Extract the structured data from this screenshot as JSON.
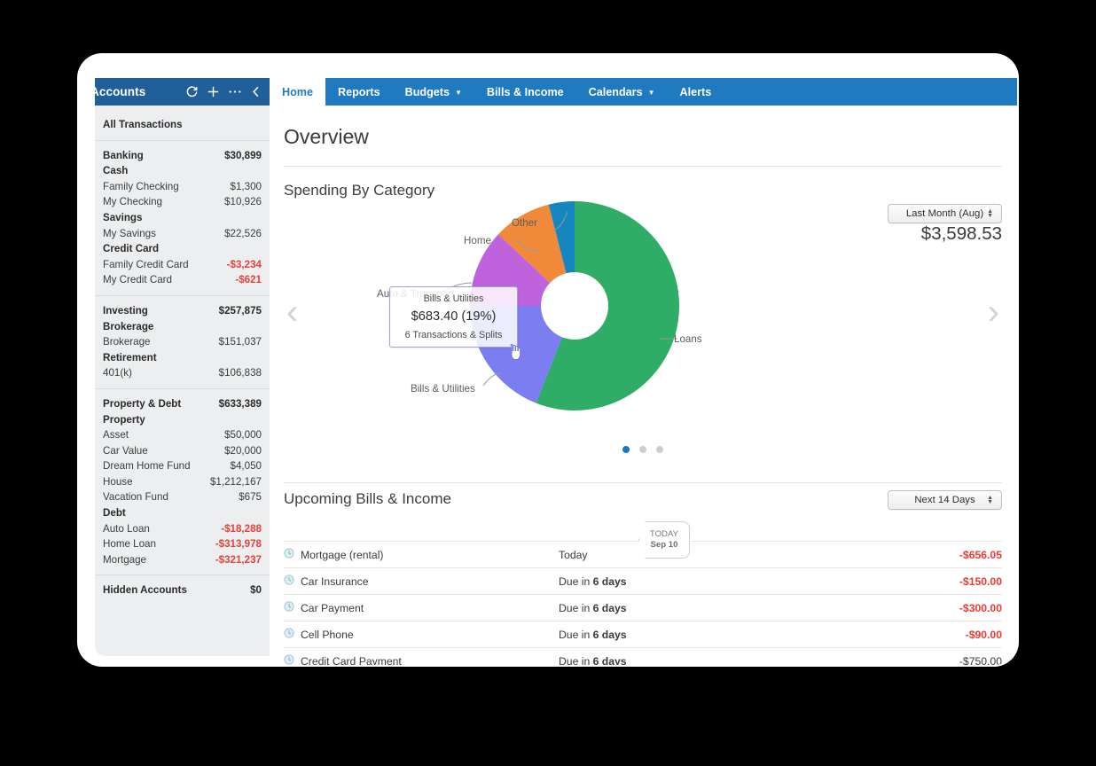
{
  "sidebar": {
    "title": "Accounts",
    "icons": [
      "refresh-icon",
      "add-icon",
      "more-icon",
      "collapse-icon"
    ],
    "all_transactions": "All Transactions",
    "groups": [
      {
        "name": "Banking",
        "total": "$30,899",
        "subgroups": [
          {
            "name": "Cash",
            "accounts": [
              {
                "name": "Family Checking",
                "value": "$1,300",
                "negative": false
              },
              {
                "name": "My Checking",
                "value": "$10,926",
                "negative": false
              }
            ]
          },
          {
            "name": "Savings",
            "accounts": [
              {
                "name": "My Savings",
                "value": "$22,526",
                "negative": false
              }
            ]
          },
          {
            "name": "Credit Card",
            "accounts": [
              {
                "name": "Family Credit Card",
                "value": "-$3,234",
                "negative": true
              },
              {
                "name": "My Credit Card",
                "value": "-$621",
                "negative": true
              }
            ]
          }
        ]
      },
      {
        "name": "Investing",
        "total": "$257,875",
        "subgroups": [
          {
            "name": "Brokerage",
            "accounts": [
              {
                "name": "Brokerage",
                "value": "$151,037",
                "negative": false
              }
            ]
          },
          {
            "name": "Retirement",
            "accounts": [
              {
                "name": "401(k)",
                "value": "$106,838",
                "negative": false
              }
            ]
          }
        ]
      },
      {
        "name": "Property & Debt",
        "total": "$633,389",
        "subgroups": [
          {
            "name": "Property",
            "accounts": [
              {
                "name": "Asset",
                "value": "$50,000",
                "negative": false
              },
              {
                "name": "Car Value",
                "value": "$20,000",
                "negative": false
              },
              {
                "name": "Dream Home Fund",
                "value": "$4,050",
                "negative": false
              },
              {
                "name": "House",
                "value": "$1,212,167",
                "negative": false
              },
              {
                "name": "Vacation Fund",
                "value": "$675",
                "negative": false
              }
            ]
          },
          {
            "name": "Debt",
            "accounts": [
              {
                "name": "Auto Loan",
                "value": "-$18,288",
                "negative": true
              },
              {
                "name": "Home Loan",
                "value": "-$313,978",
                "negative": true
              },
              {
                "name": "Mortgage",
                "value": "-$321,237",
                "negative": true
              }
            ]
          }
        ]
      }
    ],
    "hidden_accounts": {
      "name": "Hidden Accounts",
      "value": "$0"
    }
  },
  "tabs": [
    {
      "label": "Home",
      "active": true,
      "dropdown": false
    },
    {
      "label": "Reports",
      "active": false,
      "dropdown": false
    },
    {
      "label": "Budgets",
      "active": false,
      "dropdown": true
    },
    {
      "label": "Bills & Income",
      "active": false,
      "dropdown": false
    },
    {
      "label": "Calendars",
      "active": false,
      "dropdown": true
    },
    {
      "label": "Alerts",
      "active": false,
      "dropdown": false
    }
  ],
  "page": {
    "title": "Overview"
  },
  "spending": {
    "section_title": "Spending By Category",
    "period": "Last Month (Aug)",
    "total": "$3,598.53",
    "prev_arrow": "‹",
    "next_arrow": "›",
    "dots": 3,
    "active_dot": 0,
    "tooltip": {
      "category": "Bills & Utilities",
      "value": "$683.40 (19%)",
      "detail": "6 Transactions & Splits"
    }
  },
  "chart_data": {
    "type": "pie",
    "title": "Spending By Category",
    "subtitle": "Last Month (Aug)",
    "total": 3598.53,
    "total_label": "$3,598.53",
    "donut": true,
    "labels": [
      "Loans",
      "Bills & Utilities",
      "Auto & Transport",
      "Home",
      "Other"
    ],
    "values": [
      2016.0,
      683.4,
      431.82,
      323.87,
      143.94
    ],
    "percents": [
      56,
      19,
      12,
      9,
      4
    ],
    "colors": [
      "#2fac66",
      "#7b7ef0",
      "#bf63dd",
      "#f0893a",
      "#1686c0"
    ],
    "legend": "labels-on-slices",
    "highlighted": "Bills & Utilities"
  },
  "bills": {
    "section_title": "Upcoming Bills & Income",
    "range": "Next 14 Days",
    "today_marker": {
      "line1": "TODAY",
      "line2": "Sep 10"
    },
    "rows": [
      {
        "icon": "clock-icon",
        "name": "Mortgage (rental)",
        "due_prefix": "",
        "due": "Today",
        "due_bold": "",
        "amount": "-$656.05",
        "red": true
      },
      {
        "icon": "clock-icon",
        "name": "Car Insurance",
        "due_prefix": "Due in ",
        "due": "",
        "due_bold": "6 days",
        "amount": "-$150.00",
        "red": true
      },
      {
        "icon": "clock-icon",
        "name": "Car Payment",
        "due_prefix": "Due in ",
        "due": "",
        "due_bold": "6 days",
        "amount": "-$300.00",
        "red": true
      },
      {
        "icon": "clock-icon",
        "name": "Cell Phone",
        "due_prefix": "Due in ",
        "due": "",
        "due_bold": "6 days",
        "amount": "-$90.00",
        "red": true
      },
      {
        "icon": "clock-icon",
        "name": "Credit Card Payment",
        "due_prefix": "Due in ",
        "due": "",
        "due_bold": "6 days",
        "amount": "-$750.00",
        "red": false
      }
    ]
  },
  "colors": {
    "sidebar_header": "#215f9a",
    "tabbar": "#1f7ac0",
    "accent": "#1578c8",
    "negative": "#e8413a"
  }
}
